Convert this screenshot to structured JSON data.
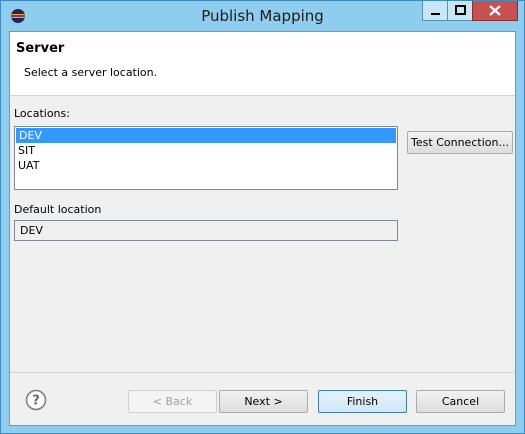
{
  "window": {
    "title": "Publish Mapping"
  },
  "header": {
    "title": "Server",
    "description": "Select a server location."
  },
  "locations": {
    "label": "Locations:",
    "items": [
      "DEV",
      "SIT",
      "UAT"
    ],
    "selected": "DEV",
    "test_button": "Test Connection..."
  },
  "default_location": {
    "label": "Default location",
    "value": "DEV"
  },
  "footer": {
    "back": "< Back",
    "next": "Next >",
    "finish": "Finish",
    "cancel": "Cancel"
  },
  "icons": {
    "app": "eclipse-icon",
    "help": "help-icon"
  },
  "colors": {
    "titlebar": "#8fcdef",
    "close": "#c75050",
    "selection": "#3399ff"
  }
}
